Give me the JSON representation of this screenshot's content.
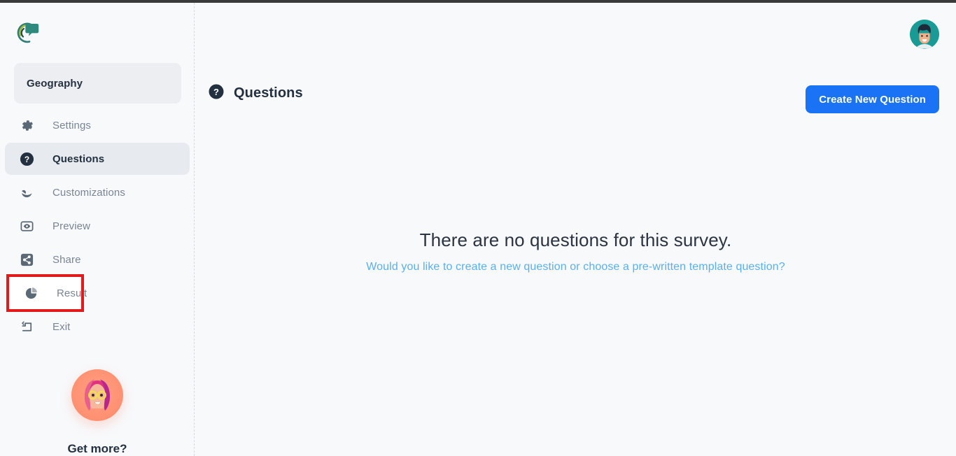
{
  "window": {
    "accent_blue": "#1a73f5",
    "link_blue": "#5aaff0",
    "annotation_red": "#e01b1b",
    "sidebar_bg": "#f8f9fb",
    "main_bg": "#f8f9fb"
  },
  "sidebar": {
    "logo_name": "survey-chat-bubble-logo",
    "survey_name": "Geography",
    "items": [
      {
        "label": "Settings",
        "icon": "gear-icon",
        "state": "default"
      },
      {
        "label": "Questions",
        "icon": "question-mark-icon",
        "state": "active"
      },
      {
        "label": "Customizations",
        "icon": "magic-wand-icon",
        "state": "default"
      },
      {
        "label": "Preview",
        "icon": "eye-icon",
        "state": "default"
      },
      {
        "label": "Share",
        "icon": "share-icon",
        "state": "default"
      },
      {
        "label": "Result",
        "icon": "pie-chart-icon",
        "state": "annotated"
      },
      {
        "label": "Exit",
        "icon": "exit-icon",
        "state": "default"
      }
    ],
    "promo": {
      "avatar_name": "woman-with-glasses-emoji",
      "title": "Get more?"
    }
  },
  "header": {
    "avatar_name": "user-avatar"
  },
  "main": {
    "title": "Questions",
    "title_icon": "question-mark-icon",
    "create_button": "Create New Question",
    "empty_state": {
      "title": "There are no questions for this survey.",
      "subtitle": "Would you like to create a new question or choose a pre-written template question?"
    }
  }
}
